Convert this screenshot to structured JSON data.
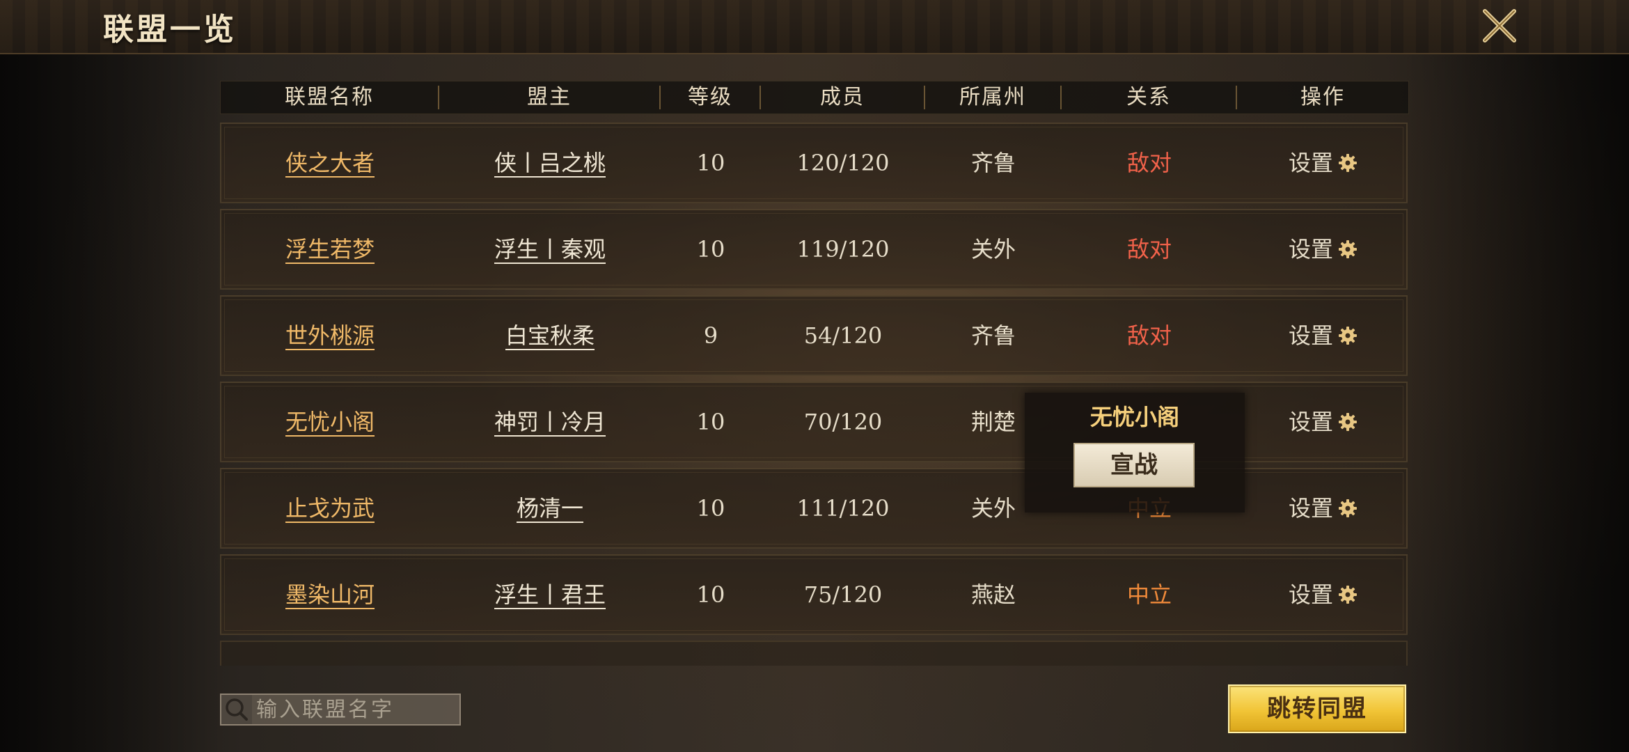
{
  "title": "联盟一览",
  "columns": [
    "联盟名称",
    "盟主",
    "等级",
    "成员",
    "所属州",
    "关系",
    "操作"
  ],
  "rows": [
    {
      "name": "侠之大者",
      "leader": "侠丨吕之桃",
      "level": "10",
      "members": "120/120",
      "region": "齐鲁",
      "relation": "敌对",
      "relation_type": "hostile",
      "action": "设置"
    },
    {
      "name": "浮生若梦",
      "leader": "浮生丨秦观",
      "level": "10",
      "members": "119/120",
      "region": "关外",
      "relation": "敌对",
      "relation_type": "hostile",
      "action": "设置"
    },
    {
      "name": "世外桃源",
      "leader": "白宝秋柔",
      "level": "9",
      "members": "54/120",
      "region": "齐鲁",
      "relation": "敌对",
      "relation_type": "hostile",
      "action": "设置"
    },
    {
      "name": "无忧小阁",
      "leader": "神罚丨冷月",
      "level": "10",
      "members": "70/120",
      "region": "荆楚",
      "relation": "",
      "relation_type": "neutral",
      "action": "设置"
    },
    {
      "name": "止戈为武",
      "leader": "杨清一",
      "level": "10",
      "members": "111/120",
      "region": "关外",
      "relation": "中立",
      "relation_type": "neutral",
      "action": "设置"
    },
    {
      "name": "墨染山河",
      "leader": "浮生丨君王",
      "level": "10",
      "members": "75/120",
      "region": "燕赵",
      "relation": "中立",
      "relation_type": "neutral",
      "action": "设置"
    }
  ],
  "popup": {
    "title": "无忧小阁",
    "button": "宣战"
  },
  "search": {
    "placeholder": "输入联盟名字",
    "value": ""
  },
  "jump_button": "跳转同盟",
  "colors": {
    "name": "#f0b968",
    "hostile": "#f2624a",
    "neutral": "#f08a3a",
    "gear": "#e8c783",
    "button_yellow": "#f1c436"
  },
  "icons": {
    "close": "close-x-icon",
    "gear": "gear-icon",
    "search": "magnifier-search-icon"
  }
}
